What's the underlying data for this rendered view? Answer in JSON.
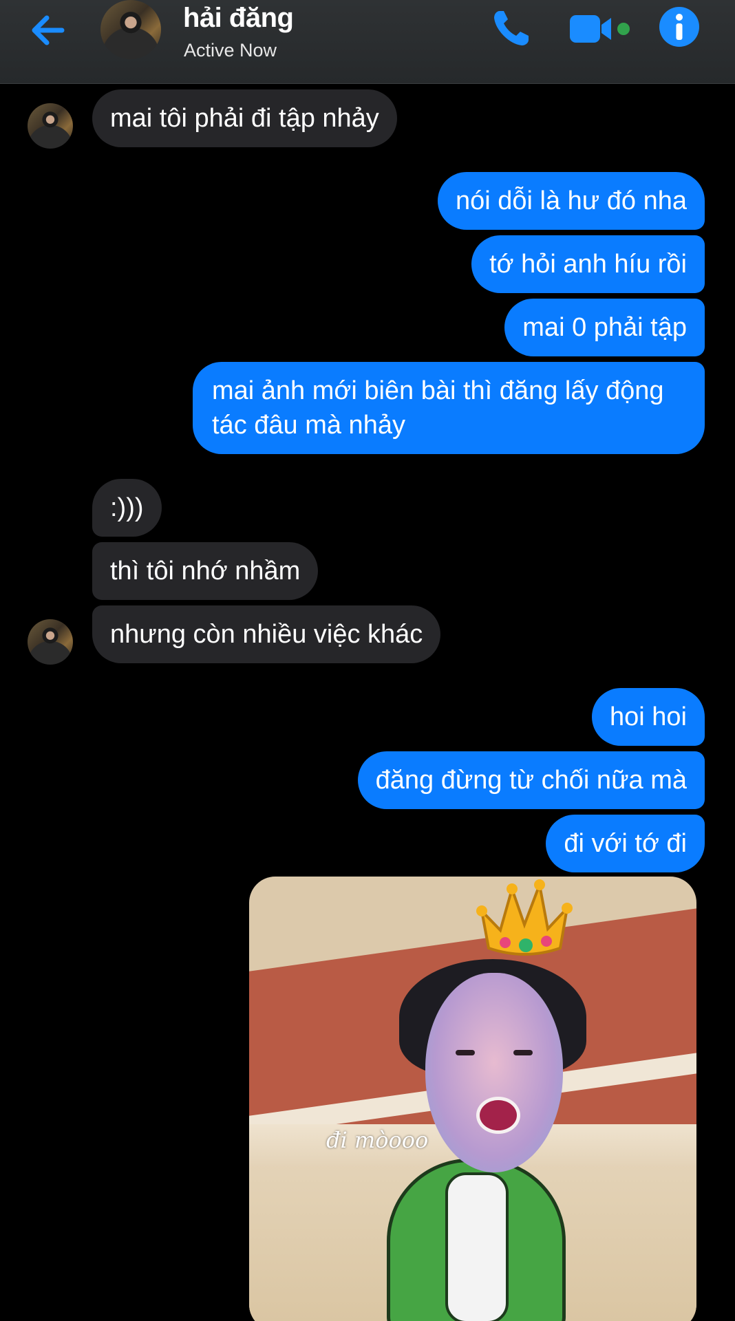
{
  "header": {
    "contact_name": "hải đăng",
    "status": "Active Now",
    "accent_color": "#1a8cff",
    "icons": [
      "back-arrow-icon",
      "phone-icon",
      "video-camera-icon",
      "info-icon"
    ]
  },
  "messages": [
    {
      "sender": "contact",
      "text": "mai tôi phải đi tập nhảy"
    },
    {
      "sender": "me",
      "text": "nói dỗi là hư đó nha"
    },
    {
      "sender": "me",
      "text": "tớ hỏi anh híu rồi"
    },
    {
      "sender": "me",
      "text": "mai 0 phải tập"
    },
    {
      "sender": "me",
      "text": "mai ảnh mới biên bài thì đăng lấy động tác đâu mà nhảy"
    },
    {
      "sender": "contact",
      "text": ":)))"
    },
    {
      "sender": "contact",
      "text": "thì tôi nhớ nhầm"
    },
    {
      "sender": "contact",
      "text": "nhưng còn nhiều việc khác"
    },
    {
      "sender": "me",
      "text": "hoi hoi"
    },
    {
      "sender": "me",
      "text": "đăng đừng từ chối nữa mà"
    },
    {
      "sender": "me",
      "text": "đi với tớ đi"
    }
  ],
  "sticker": {
    "caption": "đi mòooo"
  },
  "colors": {
    "outgoing_bubble": "#0a7cff",
    "incoming_bubble": "#262629",
    "background": "#000000",
    "online_dot": "#31a24c"
  }
}
